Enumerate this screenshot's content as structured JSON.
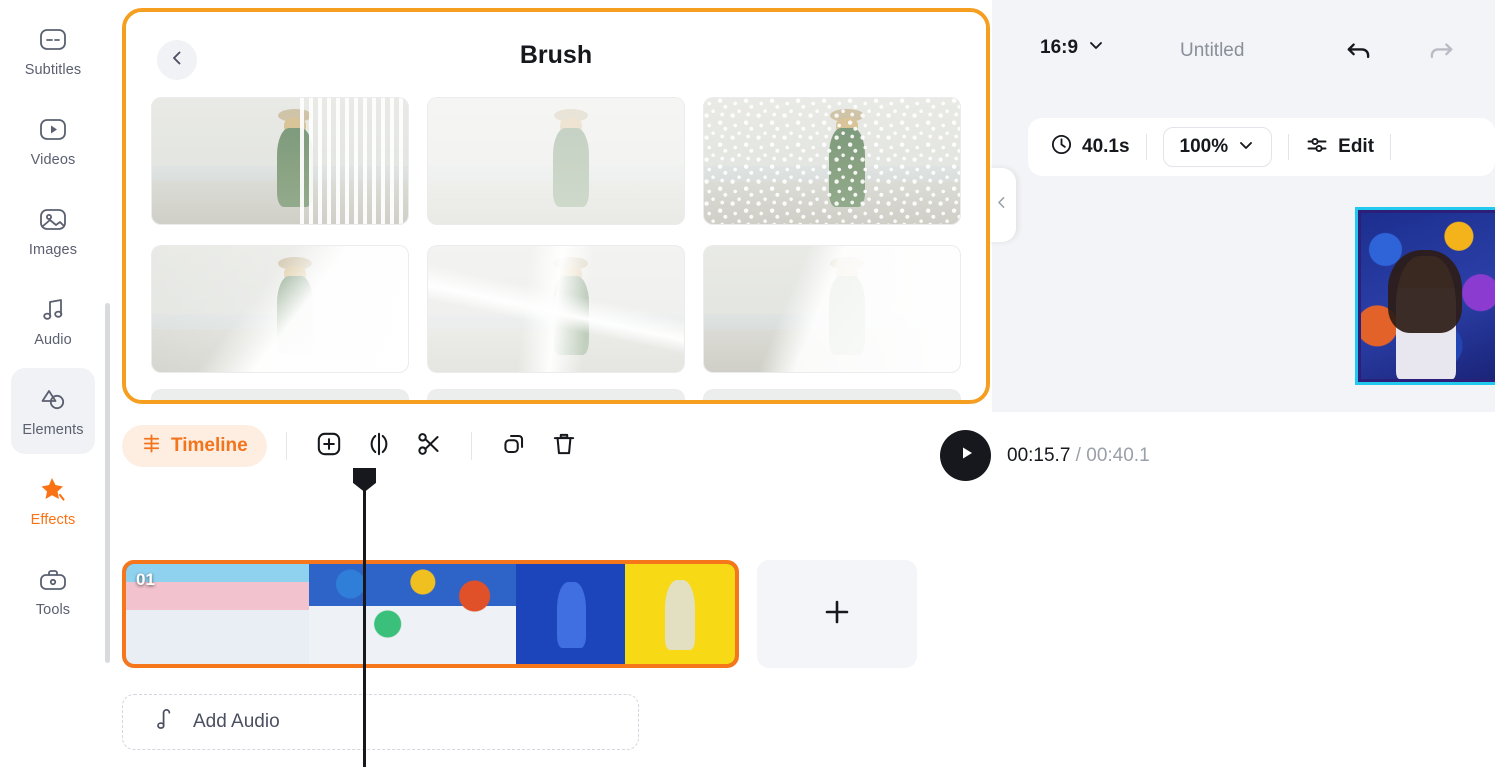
{
  "sidebar": {
    "items": [
      {
        "label": "Subtitles",
        "icon": "subtitles-icon",
        "active": false
      },
      {
        "label": "Videos",
        "icon": "video-play-icon",
        "active": false
      },
      {
        "label": "Images",
        "icon": "image-icon",
        "active": false
      },
      {
        "label": "Audio",
        "icon": "music-note-icon",
        "active": false
      },
      {
        "label": "Elements",
        "icon": "elements-shapes-icon",
        "active": true
      },
      {
        "label": "Effects",
        "icon": "sparkle-star-icon",
        "active": false
      },
      {
        "label": "Tools",
        "icon": "toolbox-icon",
        "active": false
      }
    ]
  },
  "brush_panel": {
    "title": "Brush",
    "back_icon": "chevron-left-icon",
    "collapse_icon": "chevron-left-icon",
    "highlight_color": "#f59e20",
    "items": [
      {
        "style": "brush-v"
      },
      {
        "style": "brush-full"
      },
      {
        "style": "brush-speck"
      },
      {
        "style": "brush-diag"
      },
      {
        "style": "brush-cross"
      },
      {
        "style": "brush-swipe"
      }
    ]
  },
  "header": {
    "aspect_ratio": "16:9",
    "aspect_caret": "chevron-down-icon",
    "project_title": "Untitled",
    "undo_icon": "undo-arrow-icon",
    "redo_icon": "redo-arrow-icon"
  },
  "toolbar": {
    "clock_icon": "clock-icon",
    "duration": "40.1s",
    "zoom_level": "100%",
    "zoom_caret": "chevron-down-icon",
    "edit_icon": "sliders-icon",
    "edit_label": "Edit"
  },
  "preview": {
    "selection_color": "#22c9ef"
  },
  "timeline": {
    "chip_label": "Timeline",
    "chip_icon": "timeline-icon",
    "accent_color": "#f2741d",
    "tools": [
      {
        "name": "add-media-button",
        "icon": "plus-square-icon"
      },
      {
        "name": "split-button",
        "icon": "split-icon"
      },
      {
        "name": "cut-button",
        "icon": "scissors-icon"
      },
      {
        "name": "duplicate-button",
        "icon": "copy-icon"
      },
      {
        "name": "delete-button",
        "icon": "trash-icon"
      }
    ],
    "play_icon": "play-icon",
    "time_current": "00:15.7",
    "time_separator": " / ",
    "time_total": "00:40.1",
    "clip_index": "01",
    "clip_selected_color": "#f5761b",
    "add_clip_icon": "plus-icon",
    "add_audio_label": "Add Audio",
    "add_audio_icon": "music-note-icon"
  }
}
